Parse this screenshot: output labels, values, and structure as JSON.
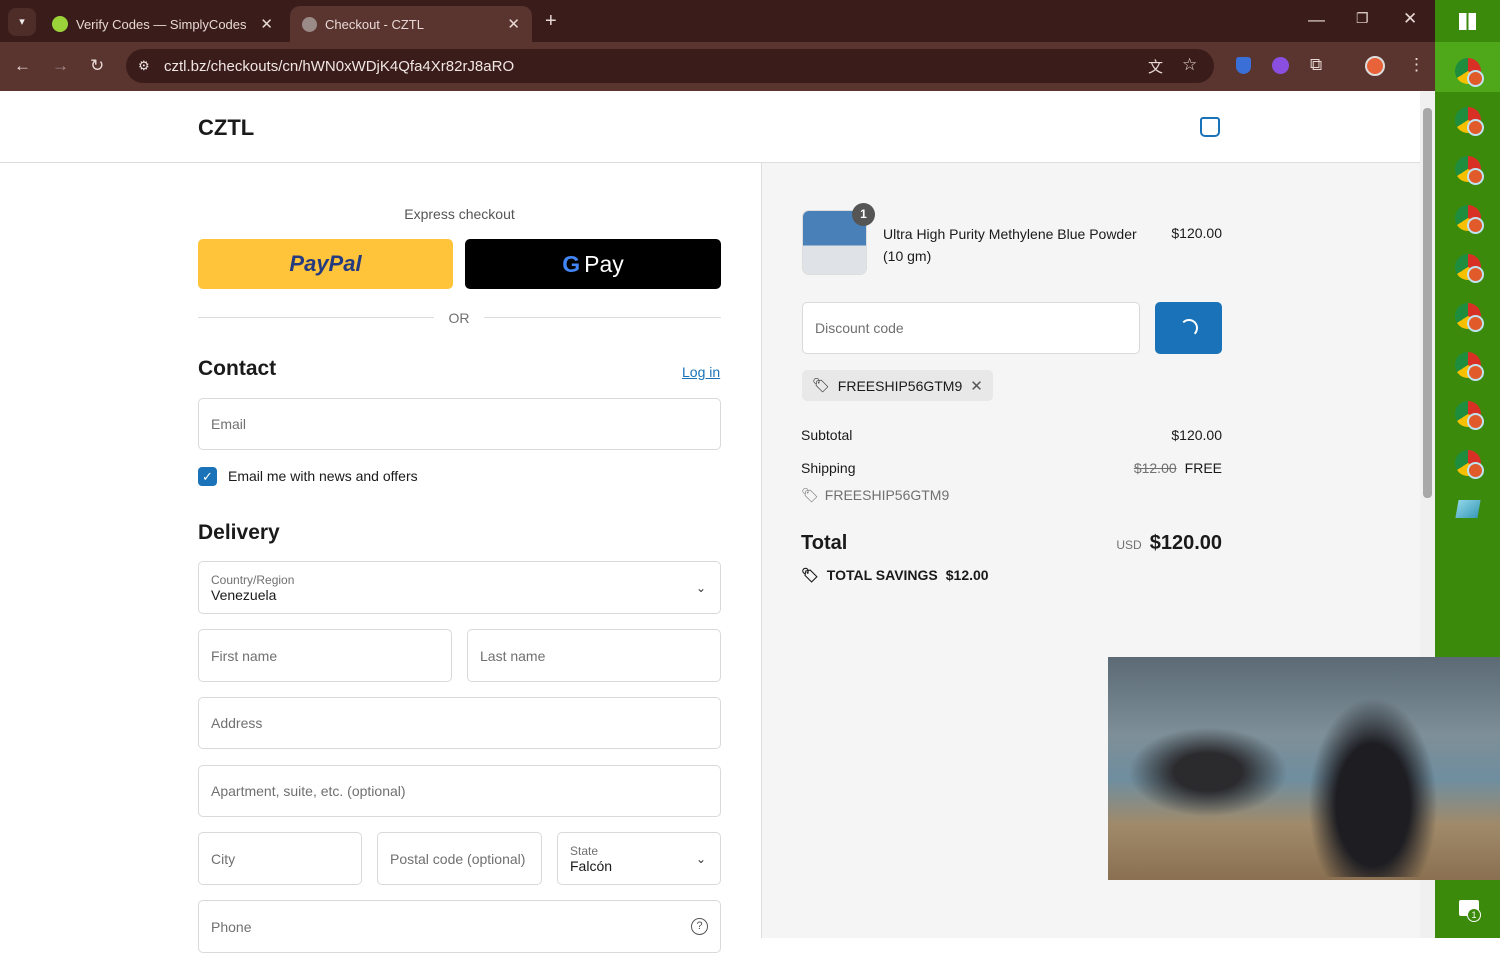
{
  "browser": {
    "tabs": [
      {
        "title": "Verify Codes — SimplyCodes"
      },
      {
        "title": "Checkout - CZTL"
      }
    ],
    "url": "cztl.bz/checkouts/cn/hWN0xWDjK4Qfa4Xr82rJ8aRO"
  },
  "store": {
    "name": "CZTL"
  },
  "express": {
    "title": "Express checkout",
    "paypal": "PayPal",
    "gpay": "Pay",
    "or": "OR"
  },
  "contact": {
    "title": "Contact",
    "login": "Log in",
    "email_placeholder": "Email",
    "newsletter": "Email me with news and offers",
    "newsletter_checked": true
  },
  "delivery": {
    "title": "Delivery",
    "country_label": "Country/Region",
    "country": "Venezuela",
    "first_name": "First name",
    "last_name": "Last name",
    "address": "Address",
    "apartment": "Apartment, suite, etc. (optional)",
    "city": "City",
    "postal": "Postal code (optional)",
    "state_label": "State",
    "state": "Falcón",
    "phone": "Phone"
  },
  "summary": {
    "item": {
      "name": "Ultra High Purity Methylene Blue Powder (10 gm)",
      "price": "$120.00",
      "qty": "1"
    },
    "discount_placeholder": "Discount code",
    "applied_code": "FREESHIP56GTM9",
    "subtotal_label": "Subtotal",
    "subtotal": "$120.00",
    "shipping_label": "Shipping",
    "shipping_old": "$12.00",
    "shipping": "FREE",
    "shipping_code": "FREESHIP56GTM9",
    "total_label": "Total",
    "currency": "USD",
    "total": "$120.00",
    "savings_label": "TOTAL SAVINGS",
    "savings": "$12.00"
  },
  "taskbar": {
    "notification_count": "1"
  }
}
